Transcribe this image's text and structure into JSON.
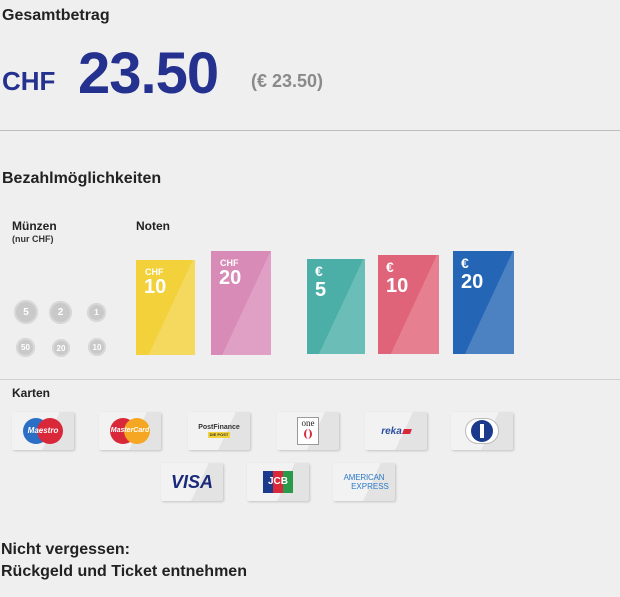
{
  "total": {
    "label": "Gesamtbetrag",
    "currency": "CHF",
    "amount": "23.50",
    "euro_amount": "(€ 23.50)"
  },
  "payment": {
    "title": "Bezahlmöglichkeiten",
    "coins": {
      "title": "Münzen",
      "subtitle": "(nur CHF)",
      "values": [
        "5",
        "2",
        "1",
        "50",
        "20",
        "10"
      ]
    },
    "notes": {
      "title": "Noten",
      "chf": [
        {
          "currency": "CHF",
          "value": "10",
          "color": "#f2d13a"
        },
        {
          "currency": "CHF",
          "value": "20",
          "color": "#d98bb8"
        }
      ],
      "euro": [
        {
          "currency": "€",
          "value": "5",
          "color": "#4bafa8"
        },
        {
          "currency": "€",
          "value": "10",
          "color": "#e06479"
        },
        {
          "currency": "€",
          "value": "20",
          "color": "#2465b5"
        }
      ]
    },
    "cards": {
      "title": "Karten",
      "logos": {
        "maestro": "Maestro",
        "mastercard": "MasterCard",
        "postfinance": "PostFinance",
        "postfinance_sub": "DIE POST",
        "one": "one",
        "reka": "reka",
        "diners": "",
        "visa": "VISA",
        "jcb": "JCB",
        "amex_line1": "AMERICAN",
        "amex_line2": "EXPRESS"
      }
    }
  },
  "reminder": {
    "line1": "Nicht vergessen:",
    "line2": "Rückgeld und Ticket entnehmen"
  }
}
